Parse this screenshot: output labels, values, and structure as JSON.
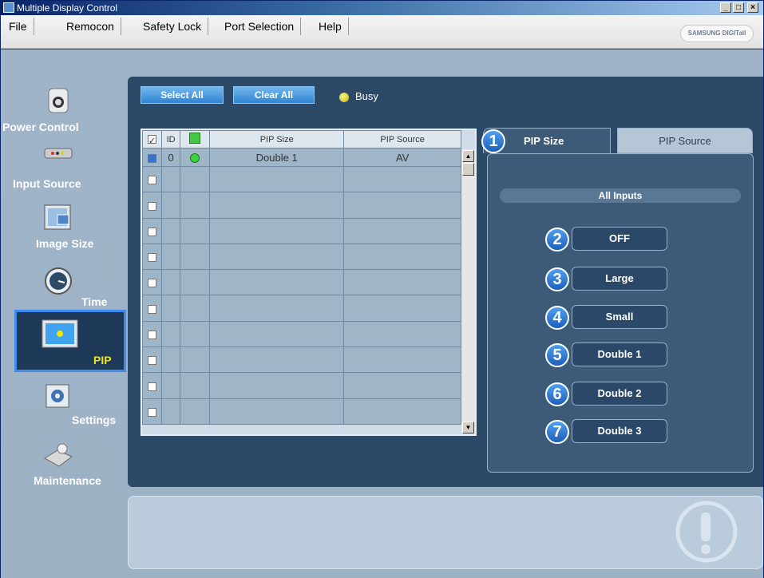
{
  "window": {
    "title": "Multiple Display Control",
    "controls": [
      "_",
      "□",
      "×"
    ]
  },
  "menubar": {
    "items": [
      "File",
      "Remocon",
      "Safety Lock",
      "Port Selection",
      "Help"
    ],
    "brand": "SAMSUNG DIGITall"
  },
  "sidebar": {
    "items": [
      {
        "label": "Power Control",
        "icon": "power-control-icon"
      },
      {
        "label": "Input Source",
        "icon": "input-source-icon"
      },
      {
        "label": "Image Size",
        "icon": "image-size-icon"
      },
      {
        "label": "Time",
        "icon": "clock-icon"
      },
      {
        "label": "PIP",
        "icon": "pip-icon",
        "active": true
      },
      {
        "label": "Settings",
        "icon": "settings-icon"
      },
      {
        "label": "Maintenance",
        "icon": "maintenance-icon"
      }
    ]
  },
  "toolbar": {
    "select_all": "Select All",
    "clear_all": "Clear All",
    "busy": "Busy"
  },
  "grid": {
    "headers": [
      "ID",
      "PIP Size",
      "PIP Source"
    ],
    "rows": [
      {
        "checked": true,
        "id": "0",
        "status": "on",
        "pip_size": "Double 1",
        "pip_source": "AV"
      },
      {
        "checked": false
      },
      {
        "checked": false
      },
      {
        "checked": false
      },
      {
        "checked": false
      },
      {
        "checked": false
      },
      {
        "checked": false
      },
      {
        "checked": false
      },
      {
        "checked": false
      },
      {
        "checked": false
      },
      {
        "checked": false
      }
    ]
  },
  "tabs": [
    {
      "label": "PIP Size",
      "number": "1",
      "active": true
    },
    {
      "label": "PIP Source",
      "active": false
    }
  ],
  "pip_size_panel": {
    "header": "All Inputs",
    "options": [
      {
        "number": "2",
        "label": "OFF"
      },
      {
        "number": "3",
        "label": "Large"
      },
      {
        "number": "4",
        "label": "Small"
      },
      {
        "number": "5",
        "label": "Double 1"
      },
      {
        "number": "6",
        "label": "Double 2"
      },
      {
        "number": "7",
        "label": "Double 3"
      }
    ]
  },
  "colors": {
    "panel": "#2c4a67",
    "nav_active_border": "#3f8cf0",
    "active_label": "#f2e400",
    "button": "#2f84d1"
  }
}
